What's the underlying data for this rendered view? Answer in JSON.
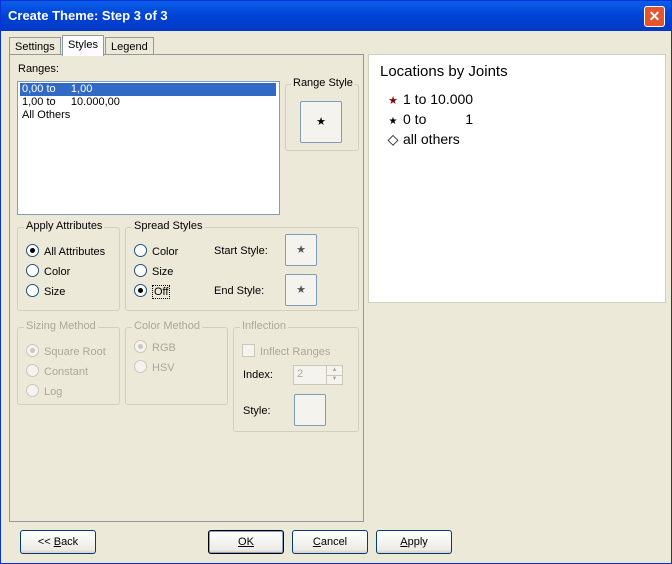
{
  "window": {
    "title": "Create Theme: Step 3 of 3",
    "close_glyph": "✕"
  },
  "tabs": [
    {
      "label": "Settings"
    },
    {
      "label": "Styles"
    },
    {
      "label": "Legend"
    }
  ],
  "ranges": {
    "label": "Ranges:",
    "items": [
      {
        "text": "0,00 to     1,00",
        "selected": true
      },
      {
        "text": "1,00 to     10.000,00",
        "selected": false
      },
      {
        "text": "All Others",
        "selected": false
      }
    ]
  },
  "range_style": {
    "label": "Range Style",
    "glyph": "★"
  },
  "apply_attributes": {
    "label": "Apply Attributes",
    "options": [
      {
        "label": "All Attributes",
        "checked": true
      },
      {
        "label": "Color",
        "checked": false
      },
      {
        "label": "Size",
        "checked": false
      }
    ]
  },
  "spread_styles": {
    "label": "Spread Styles",
    "options": [
      {
        "label": "Color",
        "checked": false
      },
      {
        "label": "Size",
        "checked": false
      },
      {
        "label": "Off",
        "checked": true
      }
    ],
    "start_label": "Start Style:",
    "end_label": "End Style:",
    "start_glyph": "★",
    "end_glyph": "★"
  },
  "sizing_method": {
    "label": "Sizing Method",
    "options": [
      {
        "label": "Square Root",
        "checked": true
      },
      {
        "label": "Constant",
        "checked": false
      },
      {
        "label": "Log",
        "checked": false
      }
    ]
  },
  "color_method": {
    "label": "Color Method",
    "options": [
      {
        "label": "RGB",
        "checked": true
      },
      {
        "label": "HSV",
        "checked": false
      }
    ]
  },
  "inflection": {
    "label": "Inflection",
    "inflect_ranges_label": "Inflect Ranges",
    "index_label": "Index:",
    "index_value": "2",
    "style_label": "Style:"
  },
  "preview": {
    "title": "Locations by Joints",
    "rows": [
      {
        "symbol": "★",
        "color": "#8b0000",
        "text": "1 to 10.000"
      },
      {
        "symbol": "★",
        "color": "#000000",
        "text": "0 to          1"
      },
      {
        "symbol": "◇",
        "color": "#000000",
        "text": "all others"
      }
    ]
  },
  "buttons": {
    "back_prefix": "<< ",
    "back_key": "B",
    "back_rest": "ack",
    "ok_key": "O",
    "ok_rest": "K",
    "cancel_key": "C",
    "cancel_rest": "ancel",
    "apply_key": "A",
    "apply_rest": "pply"
  }
}
